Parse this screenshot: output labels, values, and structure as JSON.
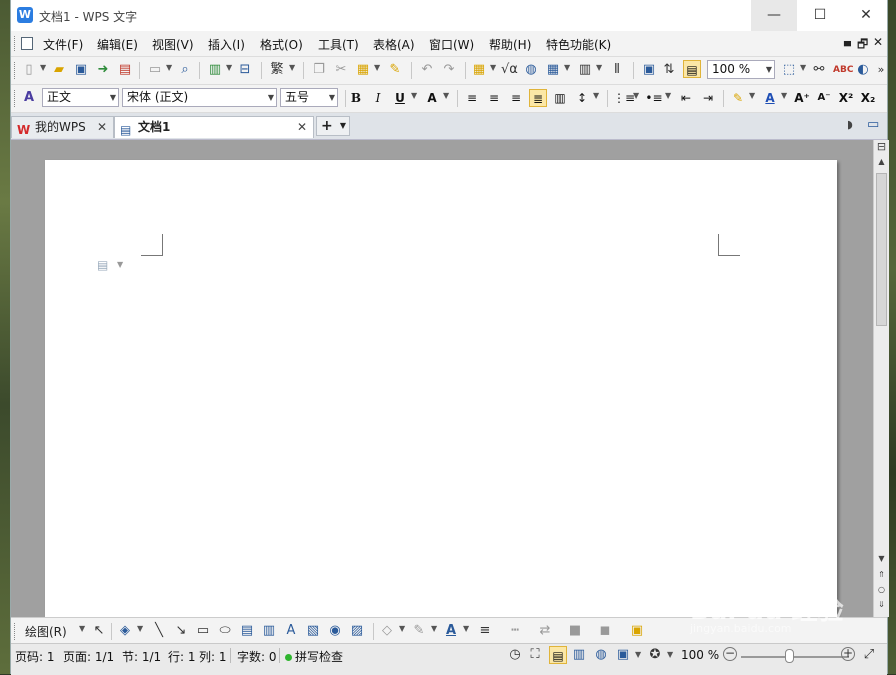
{
  "window": {
    "title": "文档1 - WPS 文字",
    "app_icon": "W",
    "min": "—",
    "max": "☐",
    "close": "✕"
  },
  "menubar": {
    "items": [
      "文件(F)",
      "编辑(E)",
      "视图(V)",
      "插入(I)",
      "格式(O)",
      "工具(T)",
      "表格(A)",
      "窗口(W)",
      "帮助(H)",
      "特色功能(K)"
    ],
    "right": [
      "▄",
      "🗗",
      "✕"
    ]
  },
  "toolbar1": {
    "zoom_value": "100 %"
  },
  "toolbar2": {
    "style": "正文",
    "font": "宋体 (正文)",
    "size": "五号",
    "bold": "B",
    "italic": "I",
    "underline": "U"
  },
  "tabs": [
    {
      "label": "我的WPS",
      "close": "✕"
    },
    {
      "label": "文档1",
      "close": "✕"
    }
  ],
  "tab_add": "+",
  "drawbar": {
    "draw_label": "绘图(R)"
  },
  "status": {
    "line_page": "页码: 1",
    "pages": "页面: 1/1",
    "section": "节: 1/1",
    "row": "行: 1",
    "col": "列: 1",
    "words": "字数: 0",
    "spell": "拼写检查",
    "zoom": "100 %",
    "zoom_out": "−",
    "zoom_in": "+"
  },
  "watermark": {
    "brand": "Bai du 经验",
    "url": "jingyan.baidu.com"
  }
}
